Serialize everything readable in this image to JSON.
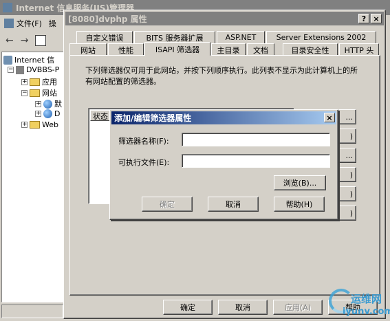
{
  "iis": {
    "title": "Internet 信息服务(IIS)管理器",
    "menu": [
      {
        "label": "文件(F)"
      },
      {
        "label": "操"
      }
    ],
    "tree": [
      {
        "label": "Internet 信"
      },
      {
        "label": "DVBBS-P"
      },
      {
        "label": "应用"
      },
      {
        "label": "网站"
      },
      {
        "label": "默"
      },
      {
        "label": "D"
      },
      {
        "label": "Web"
      }
    ]
  },
  "props": {
    "title": "[8080]dvphp 属性",
    "help_btn": "?",
    "close_btn": "×",
    "tabs_back": [
      {
        "label": "自定义错误"
      },
      {
        "label": "BITS 服务器扩展"
      },
      {
        "label": "ASP.NET"
      },
      {
        "label": "Server Extensions 2002"
      }
    ],
    "tabs_front": [
      {
        "label": "网站"
      },
      {
        "label": "性能"
      },
      {
        "label": "ISAPI 筛选器"
      },
      {
        "label": "主目录"
      },
      {
        "label": "文档"
      },
      {
        "label": "目录安全性"
      },
      {
        "label": "HTTP 头"
      }
    ],
    "description": "下列筛选器仅可用于此网站，并按下列顺序执行。此列表不显示为此计算机上的所有网站配置的筛选器。",
    "list_header": "状态",
    "side_buttons": [
      {
        "label": "..."
      },
      {
        "label": ")"
      },
      {
        "label": "..."
      },
      {
        "label": ")"
      },
      {
        "label": ")"
      },
      {
        "label": ")"
      }
    ],
    "footer": {
      "ok": "确定",
      "cancel": "取消",
      "apply": "应用(A)",
      "help": "帮助"
    }
  },
  "dialog": {
    "title": "添加/编辑筛选器属性",
    "close_btn": "×",
    "name_label": "筛选器名称(F):",
    "name_value": "",
    "exe_label": "可执行文件(E):",
    "exe_value": "",
    "browse": "浏览(B)...",
    "ok": "确定",
    "cancel": "取消",
    "help": "帮助(H)"
  },
  "watermark": {
    "line1": "运维网",
    "line2": "iyunv.com"
  }
}
